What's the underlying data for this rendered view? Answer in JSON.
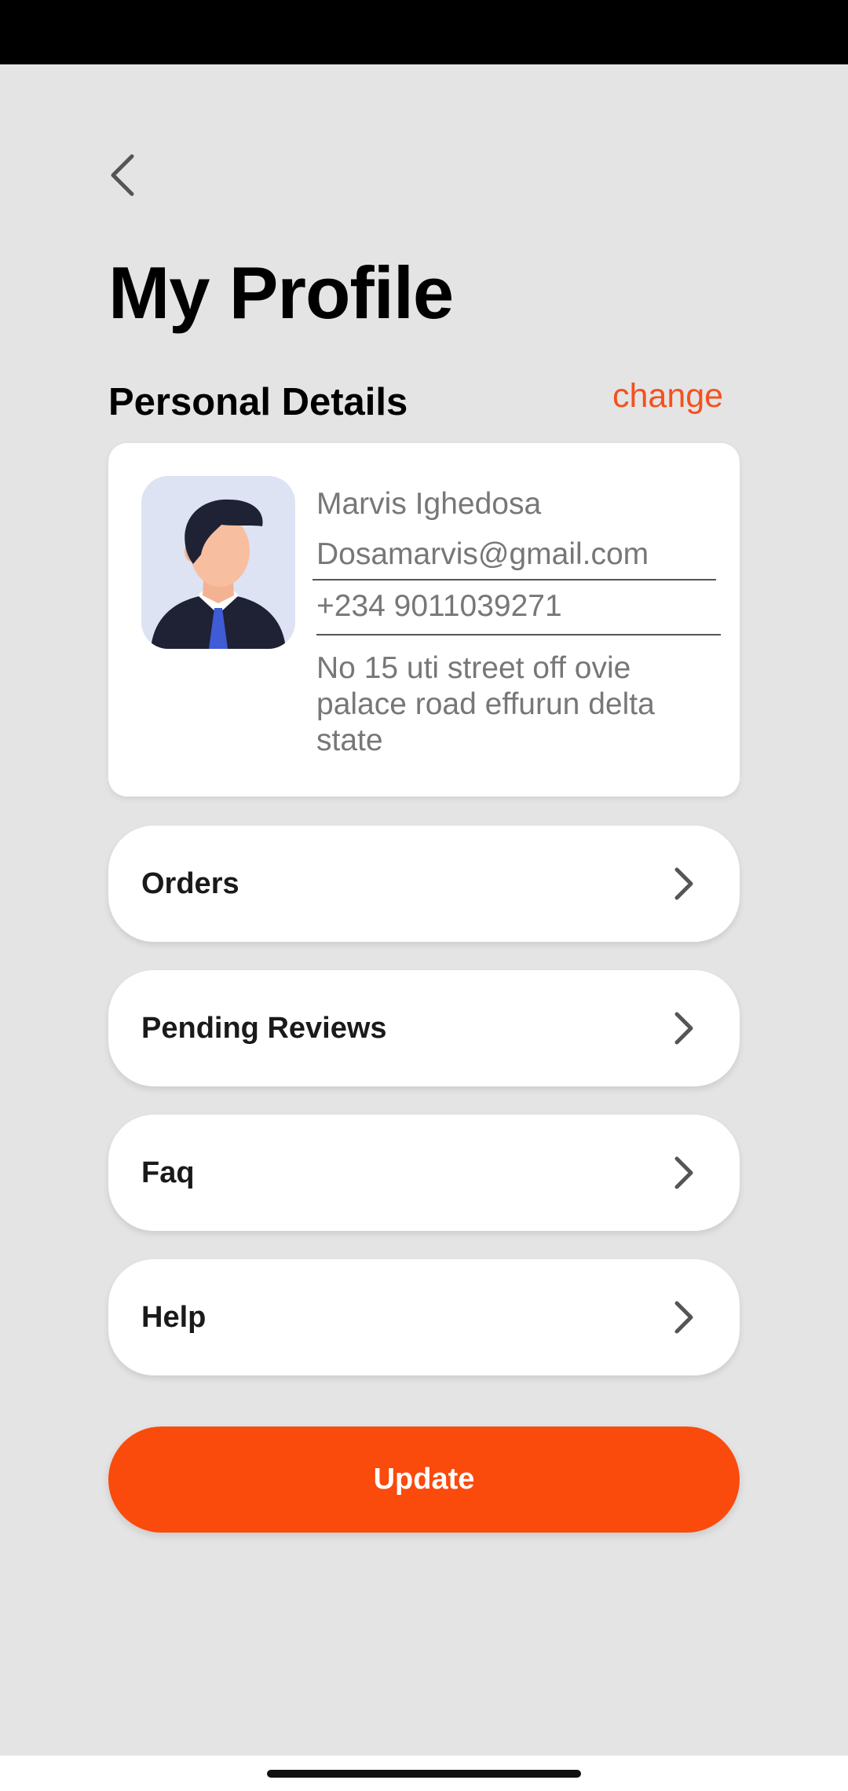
{
  "header": {
    "back_icon": "chevron-left-icon",
    "title": "My Profile"
  },
  "personal_details": {
    "section_title": "Personal Details",
    "change_label": "change",
    "avatar_icon": "user-avatar",
    "name": "Marvis Ighedosa",
    "email": "Dosamarvis@gmail.com",
    "phone": "+234 9011039271",
    "address": "No 15 uti street off ovie palace road effurun delta state"
  },
  "menu": {
    "items": [
      {
        "label": "Orders",
        "icon": "chevron-right-icon"
      },
      {
        "label": "Pending Reviews",
        "icon": "chevron-right-icon"
      },
      {
        "label": "Faq",
        "icon": "chevron-right-icon"
      },
      {
        "label": "Help",
        "icon": "chevron-right-icon"
      }
    ]
  },
  "actions": {
    "update_label": "Update"
  },
  "colors": {
    "background": "#e4e4e4",
    "accent": "#fa4a0c",
    "link": "#f4511e",
    "card": "#ffffff"
  }
}
